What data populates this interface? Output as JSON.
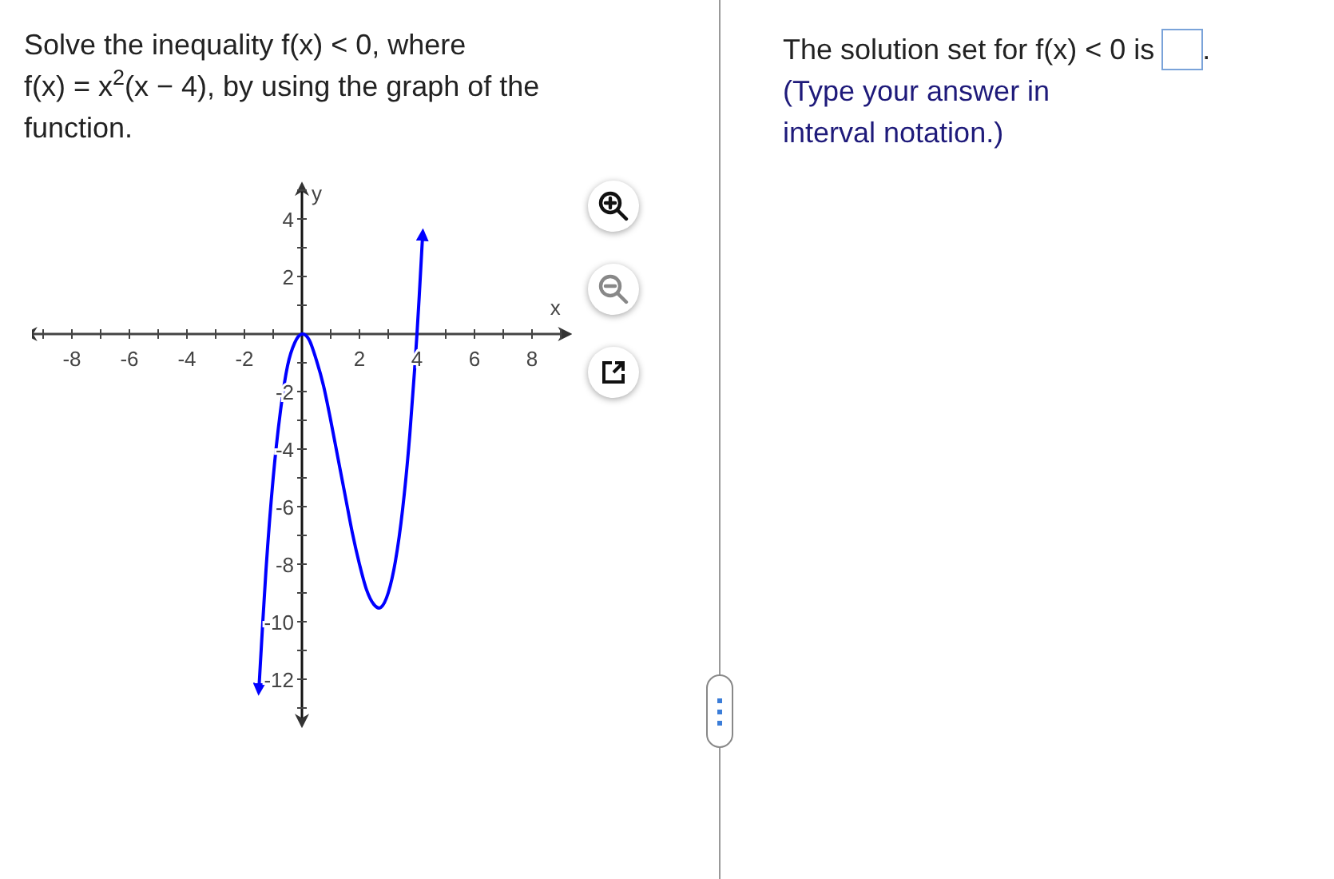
{
  "problem": {
    "lines": [
      "Solve the inequality f(x) < 0, where",
      "f(x) = x$^{2}$(x − 4), by using the graph of the",
      "function."
    ]
  },
  "graph": {
    "chart_data": {
      "type": "line",
      "xlabel": "x",
      "ylabel": "y",
      "xlim": [
        -9.6,
        9.3
      ],
      "ylim": [
        -13.6,
        5.2
      ],
      "xticks": [
        -8,
        -6,
        -4,
        -2,
        2,
        4,
        6,
        8
      ],
      "yticks": [
        -12,
        -10,
        -8,
        -6,
        -4,
        -2,
        2,
        4
      ],
      "x": [
        -1.5,
        -1.25,
        -1,
        -0.75,
        -0.5,
        -0.25,
        0,
        0.25,
        0.5,
        0.75,
        1,
        1.25,
        1.5,
        1.75,
        2,
        2.25,
        2.5,
        2.75,
        3,
        3.25,
        3.5,
        3.75,
        4,
        4.2
      ],
      "series": [
        {
          "color": "#0000ff",
          "values": [
            -12.4,
            -8.2,
            -5,
            -2.7,
            -1.1,
            -0.3,
            0,
            -0.2,
            -0.9,
            -1.8,
            -3,
            -4.3,
            -5.6,
            -6.9,
            -8,
            -8.9,
            -9.4,
            -9.5,
            -9,
            -7.9,
            -6.1,
            -3.5,
            0,
            3.5
          ]
        }
      ]
    }
  },
  "graph_tools": [
    {
      "kind": "zoom_in",
      "disabled": false
    },
    {
      "kind": "zoom_out",
      "disabled": true
    },
    {
      "kind": "popout",
      "disabled": false
    }
  ],
  "answer": {
    "prompt": "The solution set for f(x) < 0 is",
    "suffix": ".",
    "hint": "(Type your answer in interval notation.)"
  }
}
